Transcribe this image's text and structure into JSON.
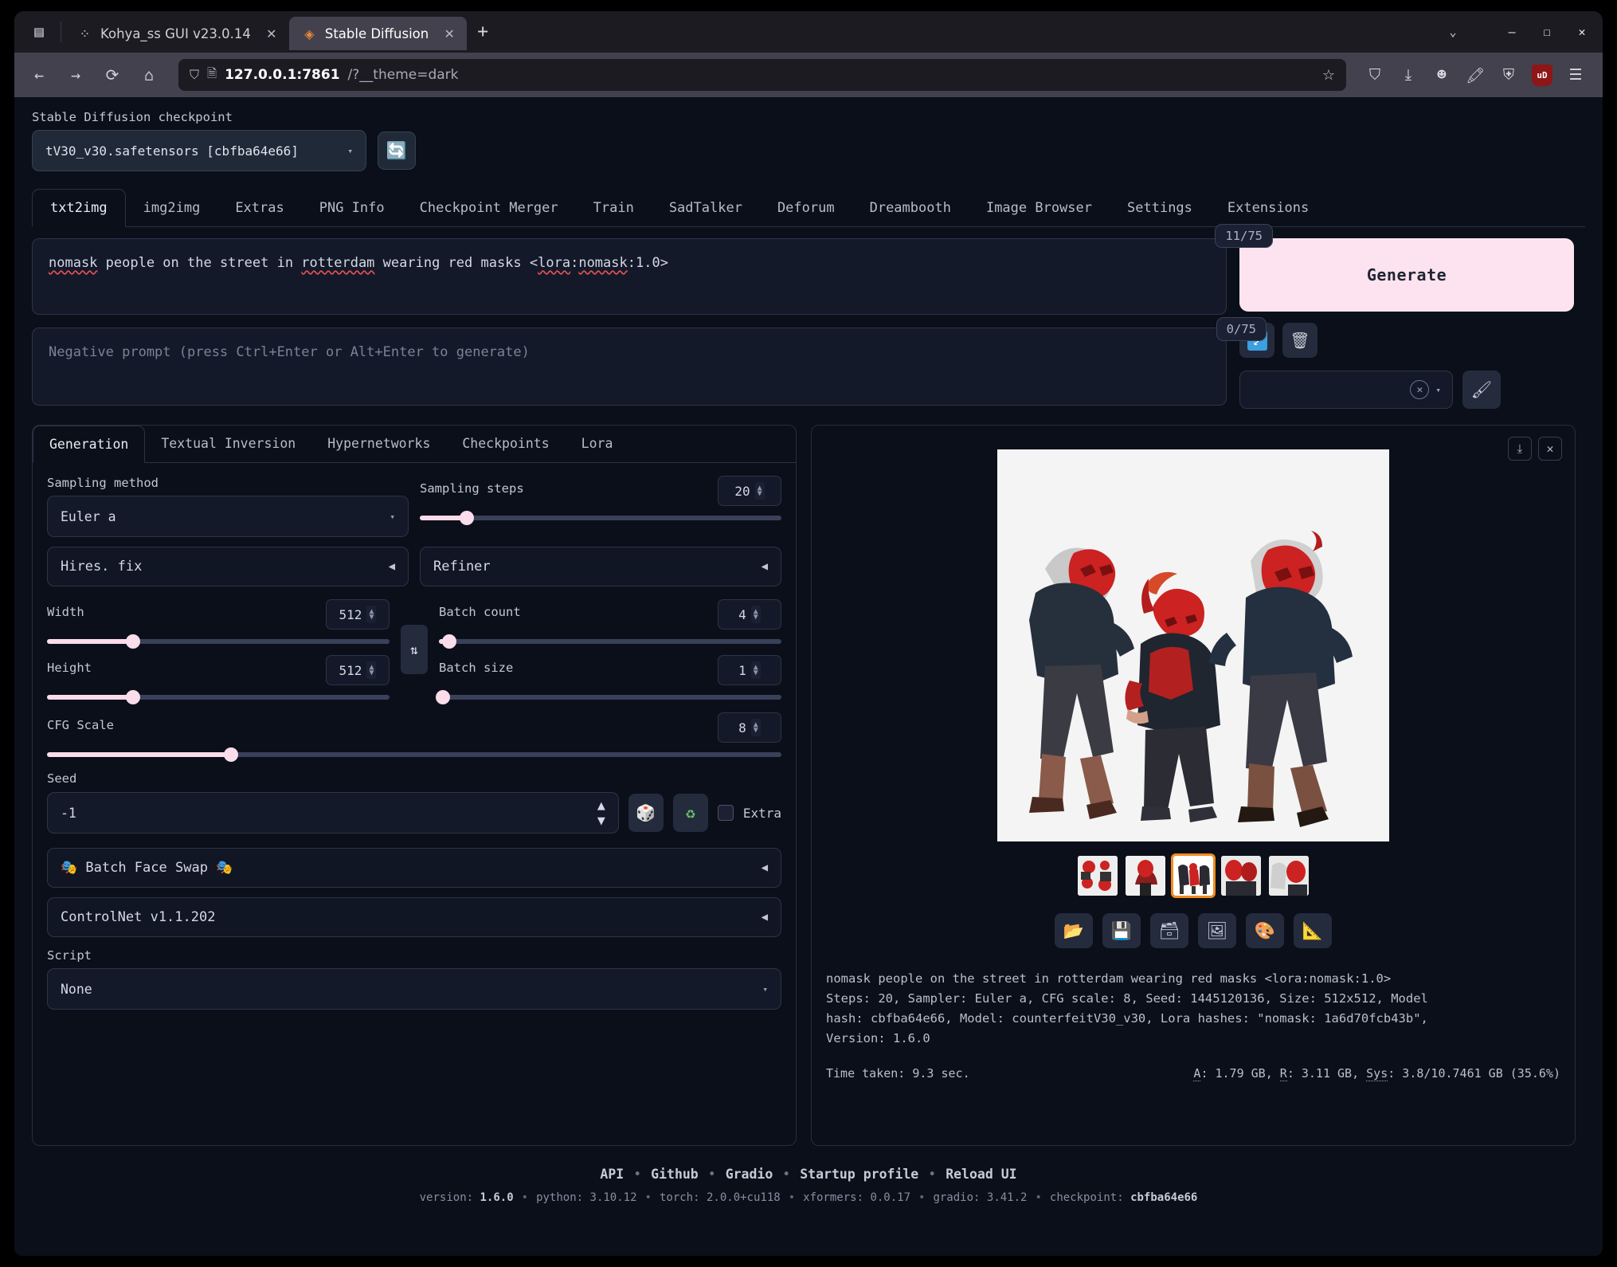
{
  "browser": {
    "tabs": [
      {
        "label": "Kohya_ss GUI v23.0.14",
        "favicon": "⁘",
        "active": false
      },
      {
        "label": "Stable Diffusion",
        "favicon": "◈",
        "active": true
      }
    ],
    "url_host": "127.0.0.1:7861",
    "url_path": "/?__theme=dark",
    "ublock_label": "uD",
    "newtab_label": "+"
  },
  "checkpoint": {
    "label": "Stable Diffusion checkpoint",
    "value": "tV30_v30.safetensors [cbfba64e66]",
    "refresh_icon": "🔄"
  },
  "main_tabs": [
    {
      "label": "txt2img",
      "active": true
    },
    {
      "label": "img2img",
      "active": false
    },
    {
      "label": "Extras",
      "active": false
    },
    {
      "label": "PNG Info",
      "active": false
    },
    {
      "label": "Checkpoint Merger",
      "active": false
    },
    {
      "label": "Train",
      "active": false
    },
    {
      "label": "SadTalker",
      "active": false
    },
    {
      "label": "Deforum",
      "active": false
    },
    {
      "label": "Dreambooth",
      "active": false
    },
    {
      "label": "Image Browser",
      "active": false
    },
    {
      "label": "Settings",
      "active": false
    },
    {
      "label": "Extensions",
      "active": false
    }
  ],
  "prompt": {
    "text_parts": [
      {
        "t": "nomask",
        "misspelled": true
      },
      {
        "t": " people on the street in ",
        "misspelled": false
      },
      {
        "t": "rotterdam",
        "misspelled": true
      },
      {
        "t": " wearing red masks  <",
        "misspelled": false
      },
      {
        "t": "lora",
        "misspelled": true
      },
      {
        "t": ":",
        "misspelled": false
      },
      {
        "t": "nomask",
        "misspelled": true
      },
      {
        "t": ":1.0>",
        "misspelled": false
      }
    ],
    "token_count": "11/75",
    "negative_placeholder": "Negative prompt (press Ctrl+Enter or Alt+Enter to generate)",
    "negative_token_count": "0/75"
  },
  "generate": {
    "label": "Generate",
    "buttons": [
      {
        "name": "restore-progress",
        "icon": "↙"
      },
      {
        "name": "clear-prompt",
        "icon": "🗑"
      }
    ],
    "styles_value": "",
    "brush_icon": "🖌"
  },
  "sub_tabs": [
    {
      "label": "Generation",
      "active": true
    },
    {
      "label": "Textual Inversion",
      "active": false
    },
    {
      "label": "Hypernetworks",
      "active": false
    },
    {
      "label": "Checkpoints",
      "active": false
    },
    {
      "label": "Lora",
      "active": false
    }
  ],
  "settings": {
    "sampling_method_label": "Sampling method",
    "sampling_method_value": "Euler a",
    "sampling_steps_label": "Sampling steps",
    "sampling_steps_value": "20",
    "sampling_steps_pct": 13,
    "hires_fix_label": "Hires. fix",
    "refiner_label": "Refiner",
    "width_label": "Width",
    "width_value": "512",
    "width_pct": 25,
    "height_label": "Height",
    "height_value": "512",
    "height_pct": 25,
    "batch_count_label": "Batch count",
    "batch_count_value": "4",
    "batch_count_pct": 3,
    "batch_size_label": "Batch size",
    "batch_size_value": "1",
    "batch_size_pct": 0,
    "cfg_label": "CFG Scale",
    "cfg_value": "8",
    "cfg_pct": 25,
    "seed_label": "Seed",
    "seed_value": "-1",
    "seed_dice_icon": "🎲",
    "seed_recycle_icon": "♻",
    "extra_label": "Extra",
    "swap_icon": "⇅",
    "batch_face_swap_label": "🎭 Batch Face Swap 🎭",
    "controlnet_label": "ControlNet v1.1.202",
    "script_label": "Script",
    "script_value": "None"
  },
  "output": {
    "download_icon": "⤓",
    "close_icon": "✕",
    "thumbnails": [
      {
        "selected": false
      },
      {
        "selected": false
      },
      {
        "selected": true
      },
      {
        "selected": false
      },
      {
        "selected": false
      }
    ],
    "actions": [
      {
        "name": "open-folder",
        "icon": "📂"
      },
      {
        "name": "save",
        "icon": "💾"
      },
      {
        "name": "save-zip",
        "icon": "🗃"
      },
      {
        "name": "send-to-img2img",
        "icon": "🖼"
      },
      {
        "name": "send-to-inpaint",
        "icon": "🎨"
      },
      {
        "name": "send-to-extras",
        "icon": "📐"
      }
    ],
    "info_lines": [
      "nomask people on the street in rotterdam wearing red masks <lora:nomask:1.0>",
      "Steps: 20, Sampler: Euler a, CFG scale: 8, Seed: 1445120136, Size: 512x512, Model",
      "hash: cbfba64e66, Model: counterfeitV30_v30, Lora hashes: \"nomask: 1a6d70fcb43b\",",
      "Version: 1.6.0"
    ],
    "time_taken": "Time taken: 9.3 sec.",
    "memory_a": "A",
    "memory_a_val": ": 1.79 GB, ",
    "memory_r": "R",
    "memory_r_val": ": 3.11 GB, ",
    "memory_sys": "Sys",
    "memory_sys_val": ": 3.8/10.7461 GB (35.6%)"
  },
  "footer": {
    "links": [
      "API",
      "Github",
      "Gradio",
      "Startup profile",
      "Reload UI"
    ],
    "version_items": [
      {
        "k": "version: ",
        "v": "1.6.0"
      },
      {
        "k": "python: ",
        "v": "3.10.12"
      },
      {
        "k": "torch: ",
        "v": "2.0.0+cu118"
      },
      {
        "k": "xformers: ",
        "v": "0.0.17"
      },
      {
        "k": "gradio: ",
        "v": "3.41.2"
      },
      {
        "k": "checkpoint: ",
        "v": "cbfba64e66"
      }
    ]
  },
  "colors": {
    "accent_pink": "#fde3f0",
    "page_bg": "#0b0f19",
    "selected_thumb": "#f08c20"
  }
}
